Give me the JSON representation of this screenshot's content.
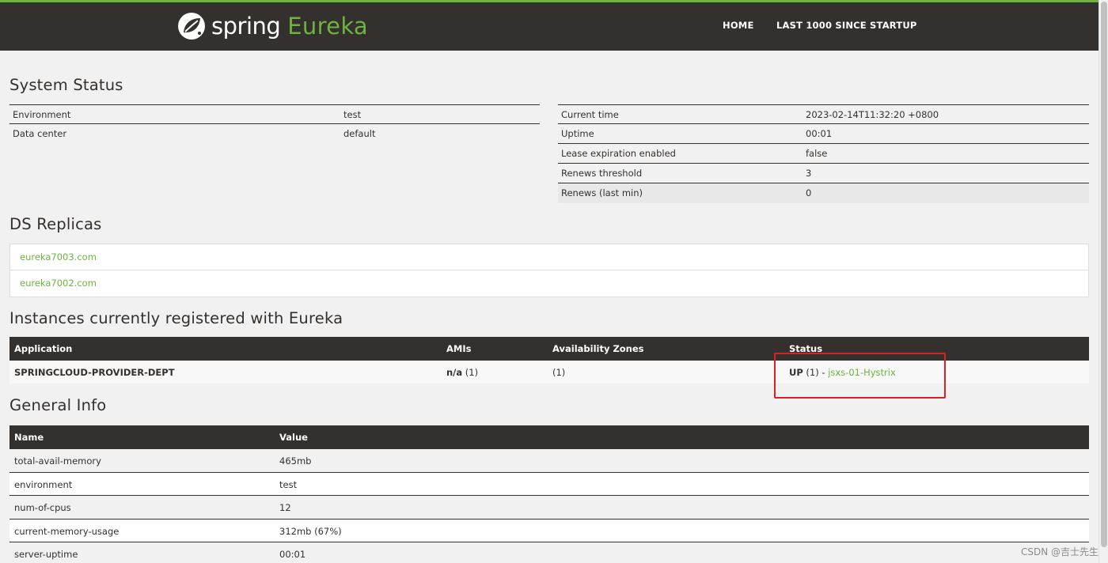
{
  "header": {
    "logo_spring": "spring",
    "logo_eureka": "Eureka",
    "nav": [
      "HOME",
      "LAST 1000 SINCE STARTUP"
    ]
  },
  "system_status": {
    "title": "System Status",
    "left": [
      {
        "label": "Environment",
        "value": "test"
      },
      {
        "label": "Data center",
        "value": "default"
      }
    ],
    "right": [
      {
        "label": "Current time",
        "value": "2023-02-14T11:32:20 +0800"
      },
      {
        "label": "Uptime",
        "value": "00:01"
      },
      {
        "label": "Lease expiration enabled",
        "value": "false"
      },
      {
        "label": "Renews threshold",
        "value": "3"
      },
      {
        "label": "Renews (last min)",
        "value": "0"
      }
    ]
  },
  "ds_replicas": {
    "title": "DS Replicas",
    "items": [
      "eureka7003.com",
      "eureka7002.com"
    ]
  },
  "instances": {
    "title": "Instances currently registered with Eureka",
    "headers": [
      "Application",
      "AMIs",
      "Availability Zones",
      "Status"
    ],
    "rows": [
      {
        "application": "SPRINGCLOUD-PROVIDER-DEPT",
        "amis_bold": "n/a",
        "amis_count": " (1)",
        "zones": "(1)",
        "status_bold": "UP",
        "status_count": " (1) - ",
        "status_link": "jsxs-01-Hystrix"
      }
    ]
  },
  "general_info": {
    "title": "General Info",
    "headers": [
      "Name",
      "Value"
    ],
    "rows": [
      {
        "name": "total-avail-memory",
        "value": "465mb"
      },
      {
        "name": "environment",
        "value": "test"
      },
      {
        "name": "num-of-cpus",
        "value": "12"
      },
      {
        "name": "current-memory-usage",
        "value": "312mb (67%)"
      },
      {
        "name": "server-uptime",
        "value": "00:01"
      }
    ]
  },
  "watermark": "CSDN @吉士先生",
  "colors": {
    "header_bg": "#34302d",
    "accent_green": "#6db33f",
    "page_bg": "#f1f1f1",
    "highlight_red": "#e02020"
  }
}
